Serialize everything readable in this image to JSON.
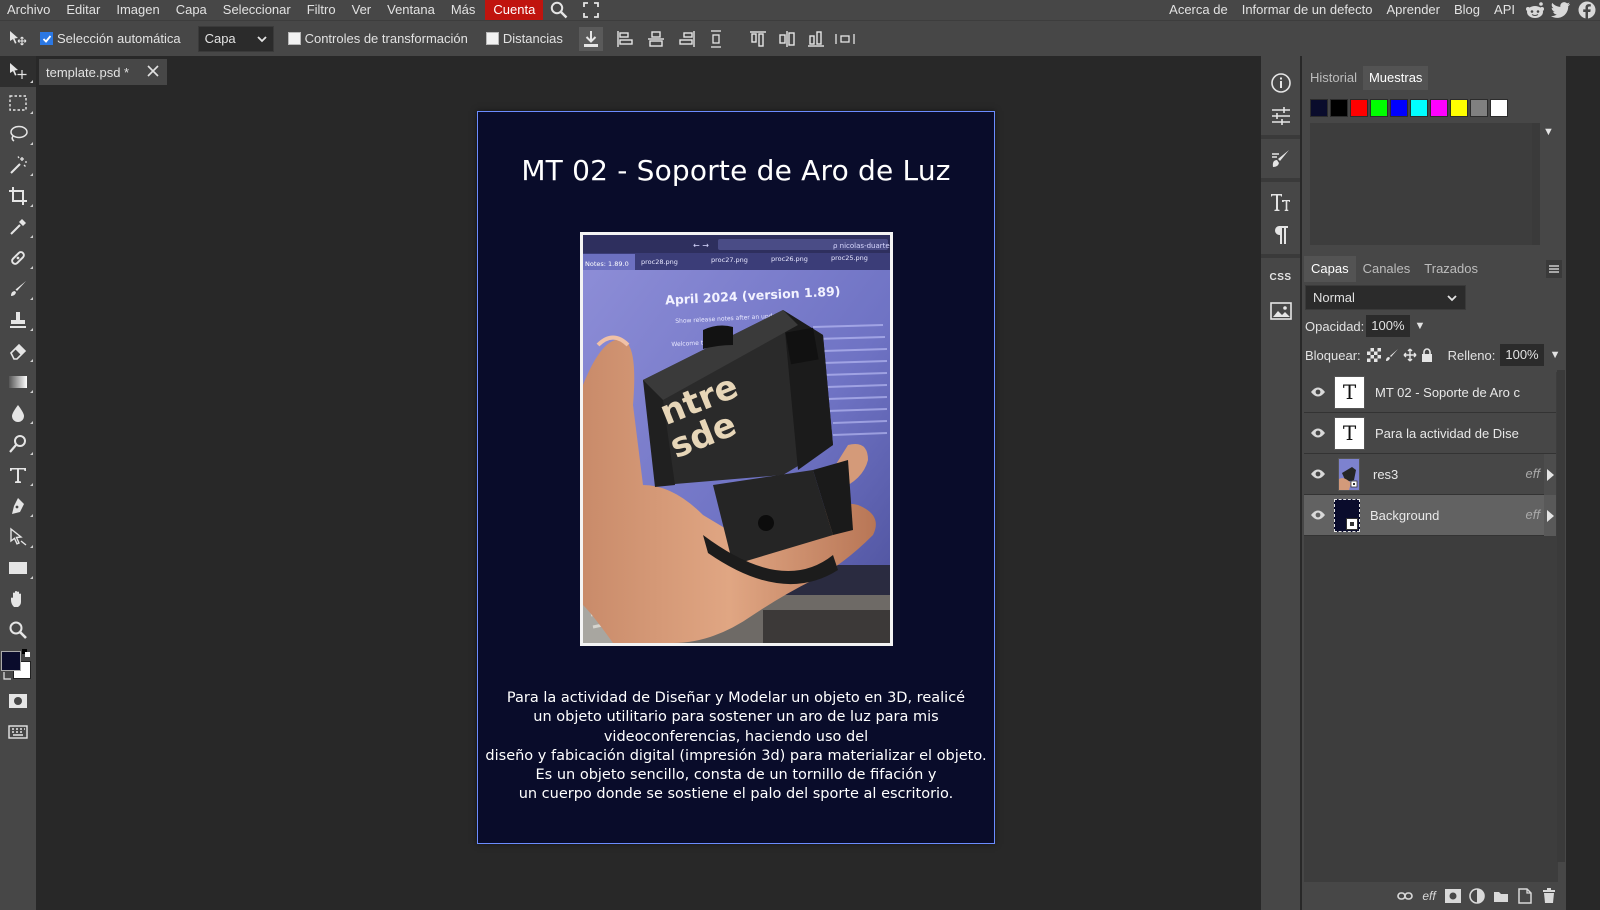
{
  "menubar": {
    "items": [
      "Archivo",
      "Editar",
      "Imagen",
      "Capa",
      "Seleccionar",
      "Filtro",
      "Ver",
      "Ventana",
      "Más"
    ],
    "account_label": "Cuenta",
    "right_links": [
      "Acerca de",
      "Informar de un defecto",
      "Aprender",
      "Blog",
      "API"
    ],
    "social_icons": [
      "reddit-icon",
      "twitter-icon",
      "facebook-icon"
    ]
  },
  "options": {
    "auto_select_label": "Selección automática",
    "auto_select_checked": true,
    "target_select": "Capa",
    "transform_controls_label": "Controles de transformación",
    "transform_controls_checked": false,
    "distances_label": "Distancias",
    "distances_checked": false
  },
  "document": {
    "tab_label": "template.psd *",
    "title": "MT 02 - Soporte de Aro de Luz",
    "body_lines": [
      "Para la actividad de Diseñar y Modelar un objeto en 3D, realicé",
      "un objeto utilitario para sostener un aro de luz para mis",
      "videoconferencias, haciendo uso del",
      "diseño y fabicación digital (impresión 3d) para materializar el objeto.",
      "Es un objeto sencillo, consta de un tornillo de fifación y",
      "un cuerpo donde se sostiene el palo del sporte al escritorio."
    ],
    "photo": {
      "screen_heading": "April 2024 (version 1.89)",
      "tabs": [
        "Notes: 1.89.0",
        "proc28.png",
        "proc27.png",
        "proc26.png",
        "proc25.png"
      ],
      "checkbox_text": "Show release notes after an update",
      "welcome_text": "Welcome to the April 2",
      "object_text": [
        "ntre",
        "sde"
      ]
    }
  },
  "panels": {
    "history_tab": "Historial",
    "swatches_tab": "Muestras",
    "swatches": [
      "#0a0c2c",
      "#000000",
      "#ff0000",
      "#00ff00",
      "#0000ff",
      "#00ffff",
      "#ff00ff",
      "#ffff00",
      "#808080",
      "#ffffff"
    ],
    "layers_tab": "Capas",
    "channels_tab": "Canales",
    "paths_tab": "Trazados",
    "blend_mode": "Normal",
    "opacity_label": "Opacidad:",
    "opacity_value": "100%",
    "lock_label": "Bloquear:",
    "fill_label": "Relleno:",
    "fill_value": "100%",
    "layers": [
      {
        "name": "MT 02 - Soporte de Aro c",
        "type": "text",
        "eff": ""
      },
      {
        "name": "Para la actividad de Dise",
        "type": "text",
        "eff": ""
      },
      {
        "name": "res3",
        "type": "image",
        "eff": "eff"
      },
      {
        "name": "Background",
        "type": "fill",
        "eff": "eff"
      }
    ],
    "right_icons_labels": {
      "css": "CSS"
    }
  },
  "colors": {
    "foreground": "#0a0c2c",
    "background": "#ffffff",
    "accent": "#c0140e",
    "canvas_border": "#6b8cff"
  }
}
